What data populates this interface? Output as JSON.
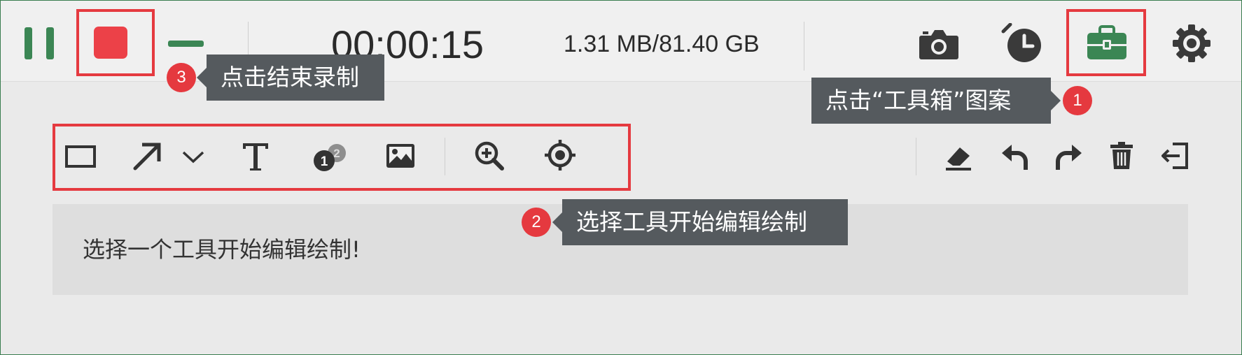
{
  "recorder": {
    "timer": "00:00:15",
    "file_size": "1.31 MB/81.40 GB"
  },
  "icons": {
    "pause": "pause-icon",
    "stop": "stop-icon",
    "minimize": "minimize-icon",
    "screenshot": "camera-icon",
    "schedule": "timer-clock-icon",
    "toolbox": "toolbox-icon",
    "settings": "gear-icon"
  },
  "tools": [
    {
      "name": "rectangle-icon"
    },
    {
      "name": "arrow-icon"
    },
    {
      "name": "chevron-down-icon"
    },
    {
      "name": "text-icon"
    },
    {
      "name": "step-number-icon"
    },
    {
      "name": "image-icon"
    },
    {
      "name": "zoom-in-icon"
    },
    {
      "name": "spotlight-icon"
    },
    {
      "name": "eraser-icon"
    },
    {
      "name": "undo-icon"
    },
    {
      "name": "redo-icon"
    },
    {
      "name": "trash-icon"
    },
    {
      "name": "exit-icon"
    }
  ],
  "step_badge_glyphs": {
    "front": "1",
    "back": "2"
  },
  "hint": {
    "text": "选择一个工具开始编辑绘制!"
  },
  "annotations": [
    {
      "number": "1",
      "text": "点击“工具箱”图案"
    },
    {
      "number": "2",
      "text": "选择工具开始编辑绘制"
    },
    {
      "number": "3",
      "text": "点击结束录制"
    }
  ],
  "colors": {
    "accent_green": "#3b8654",
    "stop_red": "#ec4148",
    "highlight_red": "#e53a40",
    "tooltip_bg": "#555a5e"
  }
}
